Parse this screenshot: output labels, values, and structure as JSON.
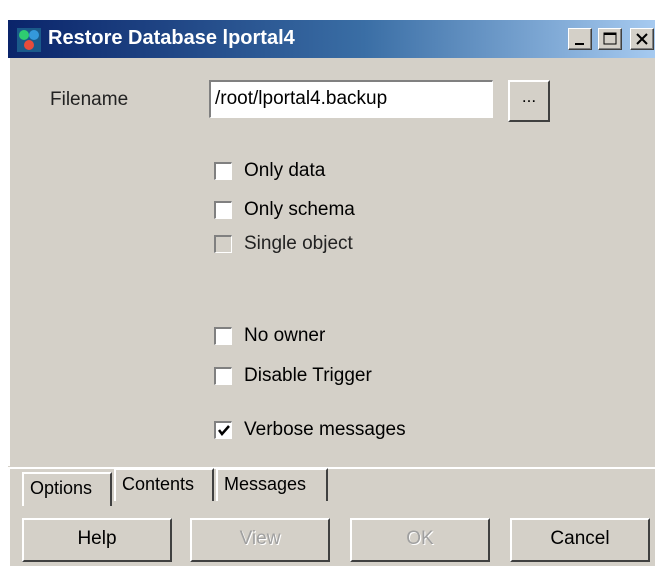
{
  "window": {
    "title": "Restore Database lportal4"
  },
  "form": {
    "filename_label": "Filename",
    "filename_value": "/root/lportal4.backup",
    "browse_label": "..."
  },
  "options": [
    {
      "label": "Only data",
      "checked": false,
      "enabled": true
    },
    {
      "label": "Only schema",
      "checked": false,
      "enabled": true
    },
    {
      "label": "Single object",
      "checked": false,
      "enabled": false
    },
    {
      "label": "No owner",
      "checked": false,
      "enabled": true
    },
    {
      "label": "Disable Trigger",
      "checked": false,
      "enabled": true
    },
    {
      "label": "Verbose messages",
      "checked": true,
      "enabled": true
    }
  ],
  "tabs": [
    {
      "label": "Options",
      "active": true
    },
    {
      "label": "Contents",
      "active": false
    },
    {
      "label": "Messages",
      "active": false
    }
  ],
  "buttons": {
    "help": "Help",
    "view": "View",
    "ok": "OK",
    "cancel": "Cancel"
  }
}
